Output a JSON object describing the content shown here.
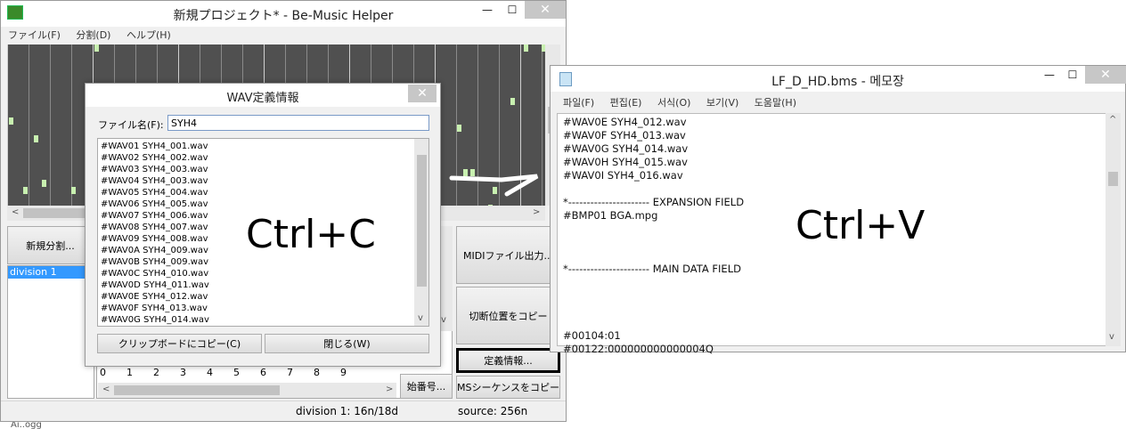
{
  "main_window": {
    "title": "新規プロジェクト* - Be-Music Helper",
    "menu": [
      "ファイル(F)",
      "分割(D)",
      "ヘルプ(H)"
    ],
    "buttons": {
      "new_division": "新規分割...",
      "midi_output": "MIDIファイル出力...",
      "copy_cut_pos": "切断位置をコピー",
      "definition_info": "定義情報...",
      "start_number": "始番号...",
      "copy_ms_sequence": "MSシーケンスをコピー"
    },
    "division_list": [
      "division 1"
    ],
    "ruler": [
      "0",
      "1",
      "2",
      "3",
      "4",
      "5",
      "6",
      "7",
      "8",
      "9"
    ],
    "status_left": "division 1: 16n/18d",
    "status_right": "source: 256n",
    "bottom_edge_text": "Ai..ogg"
  },
  "dialog": {
    "title": "WAV定義情報",
    "filename_label": "ファイル名(F):",
    "filename_value": "SYH4",
    "lines": [
      "#WAV01 SYH4_001.wav",
      "#WAV02 SYH4_002.wav",
      "#WAV03 SYH4_003.wav",
      "#WAV04 SYH4_003.wav",
      "#WAV05 SYH4_004.wav",
      "#WAV06 SYH4_005.wav",
      "#WAV07 SYH4_006.wav",
      "#WAV08 SYH4_007.wav",
      "#WAV09 SYH4_008.wav",
      "#WAV0A SYH4_009.wav",
      "#WAV0B SYH4_009.wav",
      "#WAV0C SYH4_010.wav",
      "#WAV0D SYH4_011.wav",
      "#WAV0E SYH4_012.wav",
      "#WAV0F SYH4_013.wav",
      "#WAV0G SYH4_014.wav"
    ],
    "copy_button": "クリップボードにコピー(C)",
    "close_button": "閉じる(W)"
  },
  "overlay": {
    "ctrl_c": "Ctrl+C",
    "ctrl_v": "Ctrl+V"
  },
  "notepad": {
    "title": "LF_D_HD.bms - 메모장",
    "menu": [
      "파일(F)",
      "편집(E)",
      "서식(O)",
      "보기(V)",
      "도움말(H)"
    ],
    "lines": [
      "#WAV0E SYH4_012.wav",
      "#WAV0F SYH4_013.wav",
      "#WAV0G SYH4_014.wav",
      "#WAV0H SYH4_015.wav",
      "#WAV0I SYH4_016.wav",
      "",
      "*---------------------- EXPANSION FIELD",
      "#BMP01 BGA.mpg",
      "",
      "",
      "",
      "*---------------------- MAIN DATA FIELD",
      "",
      "",
      "",
      "",
      "#00104:01",
      "#00122:000000000000004Q"
    ]
  },
  "colors": {
    "grid_bg": "#505050",
    "note": "#c8f0b0",
    "selection": "#3399ff",
    "highlight_box": "#000000"
  }
}
